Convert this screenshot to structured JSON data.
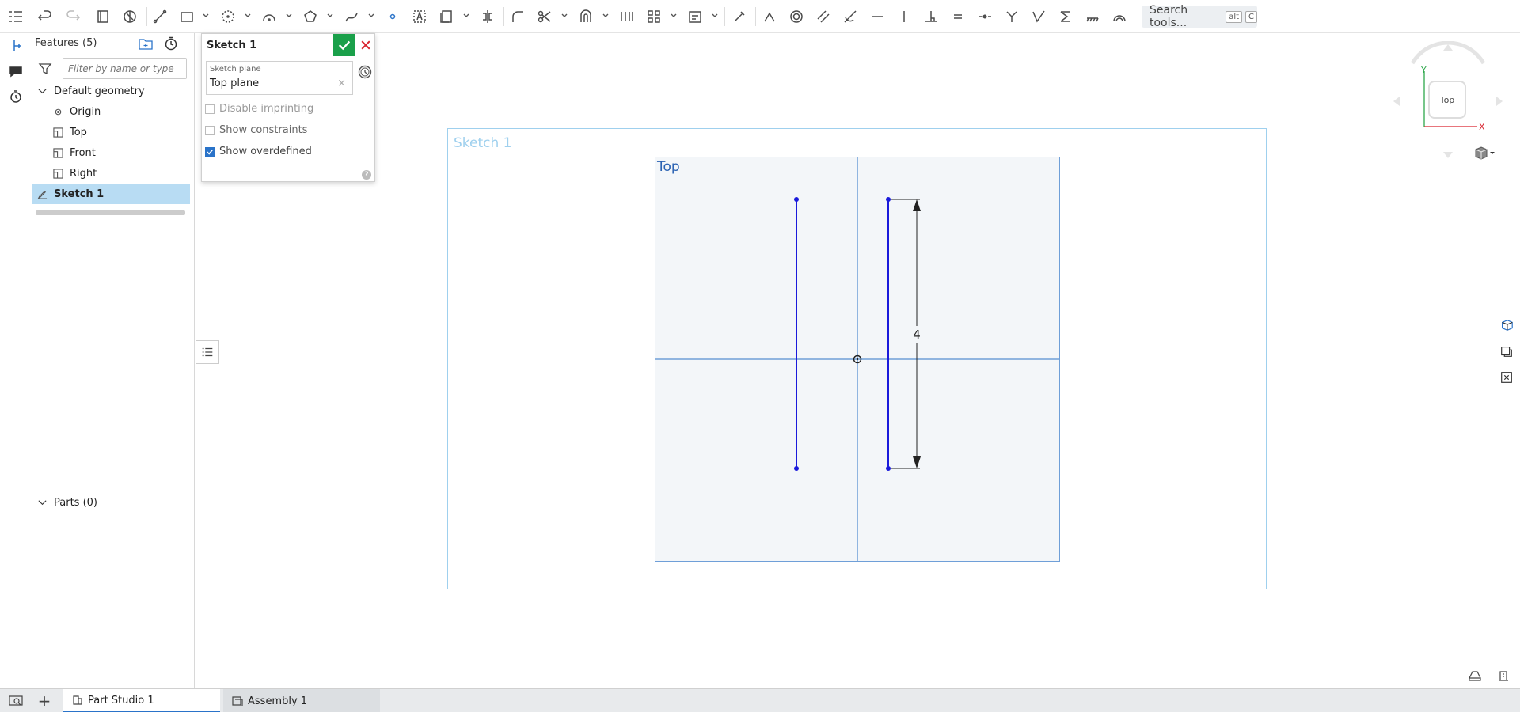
{
  "toolbar": {
    "search_label": "Search tools...",
    "search_key1": "alt",
    "search_key2": "C"
  },
  "features": {
    "title": "Features (5)",
    "filter_placeholder": "Filter by name or type",
    "default_geometry": "Default geometry",
    "items": [
      "Origin",
      "Top",
      "Front",
      "Right"
    ],
    "sketch": "Sketch 1",
    "parts": "Parts (0)"
  },
  "dialog": {
    "title": "Sketch 1",
    "plane_label": "Sketch plane",
    "plane_value": "Top plane",
    "checks": [
      {
        "label": "Disable imprinting",
        "checked": false
      },
      {
        "label": "Show constraints",
        "checked": false
      },
      {
        "label": "Show overdefined",
        "checked": true
      }
    ],
    "help": "?"
  },
  "viewport": {
    "frame_title": "Sketch 1",
    "plane_title": "Top",
    "dimension_value": "4",
    "cube_face": "Top",
    "axis_y": "Y",
    "axis_x": "X"
  },
  "tabs": [
    {
      "label": "Part Studio 1"
    },
    {
      "label": "Assembly 1"
    }
  ],
  "colors": {
    "accent": "#2a73c9",
    "sketch_line": "#1a1adb",
    "ok_green": "#1aa04a",
    "cancel_red": "#d9232e",
    "selection": "#b8dcf3"
  }
}
